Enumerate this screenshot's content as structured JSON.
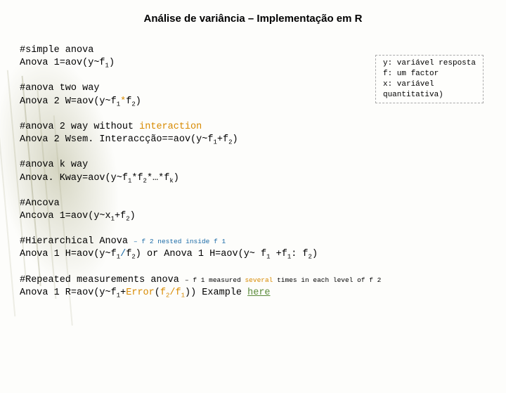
{
  "title": "Análise de variância – Implementação em R",
  "legend": {
    "l1": "y: variável resposta",
    "l2": "f: um factor",
    "l3": "x: variável",
    "l4": "quantitativa)"
  },
  "b1": {
    "c": "#simple anova",
    "code_a": "Anova 1=aov(y~f",
    "sub1": "1",
    "code_b": ")"
  },
  "b2": {
    "c": "#anova two way",
    "a": "Anova 2 W=aov(y~f",
    "s1": "1",
    "m": "*",
    "b": "f",
    "s2": "2",
    "end": ")"
  },
  "b3": {
    "c1": "#anova 2 way without ",
    "c2": "interaction",
    "a": "Anova 2 Wsem. Interaccção==aov(y~f",
    "s1": "1",
    "plus": "+f",
    "s2": "2",
    "end": ")"
  },
  "b4": {
    "c": "#anova k way",
    "a": "Anova. Kway=aov(y~f",
    "s1": "1",
    "m1": "*f",
    "s2": "2",
    "m2": "*…*f",
    "sk": "k",
    "end": ")"
  },
  "b5": {
    "c": "#Ancova",
    "a": "Ancova 1=aov(y~x",
    "s1": "1",
    "plus": "+f",
    "s2": "2",
    "end": ")"
  },
  "b6": {
    "c": "#Hierarchical Anova ",
    "note": "– f 2 nested inside f 1",
    "a": "Anova 1 H=aov(y~f",
    "s1": "1",
    "sl": "/",
    "fb": "f",
    "s2": "2",
    "mid": ") or Anova 1 H=aov(y~ f",
    "s3": "1",
    "plus": " +f",
    "s4": "1",
    "colon": ": f",
    "s5": "2",
    "end": ")"
  },
  "b7": {
    "c": "#Repeated measurements anova ",
    "note1": "– f 1 measured ",
    "note2": "several",
    "note3": " times in each level of f 2",
    "a": "Anova 1 R=aov(y~f",
    "s1": "1",
    "err1": "+",
    "err2": "Error",
    "p1": "(",
    "fa": "f",
    "s2": "2",
    "sl": "/f",
    "s3": "1",
    "p2": ")) Example ",
    "link": "here"
  }
}
